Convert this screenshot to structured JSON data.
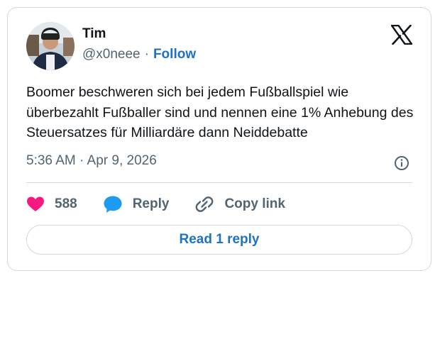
{
  "author": {
    "name": "Tim",
    "handle": "@x0neee",
    "separator": "·",
    "follow_label": "Follow",
    "avatar_icon": "avatar-photo"
  },
  "platform_icon": "x-logo-icon",
  "tweet": {
    "text": "Boomer beschweren sich bei jedem Fußballspiel wie überbezahlt Fußballer sind und nennen eine 1% Anhebung des Steuersatzes für Milliardäre dann Neiddebatte",
    "timestamp": "5:36 AM · Apr 9, 2026"
  },
  "actions": {
    "like_count": "588",
    "reply_label": "Reply",
    "copy_link_label": "Copy link"
  },
  "read_replies_label": "Read 1 reply",
  "colors": {
    "like": "#f91880",
    "reply": "#1d9bf0",
    "link": "#1d72c6",
    "border": "#cfd9de",
    "muted": "#536471"
  }
}
